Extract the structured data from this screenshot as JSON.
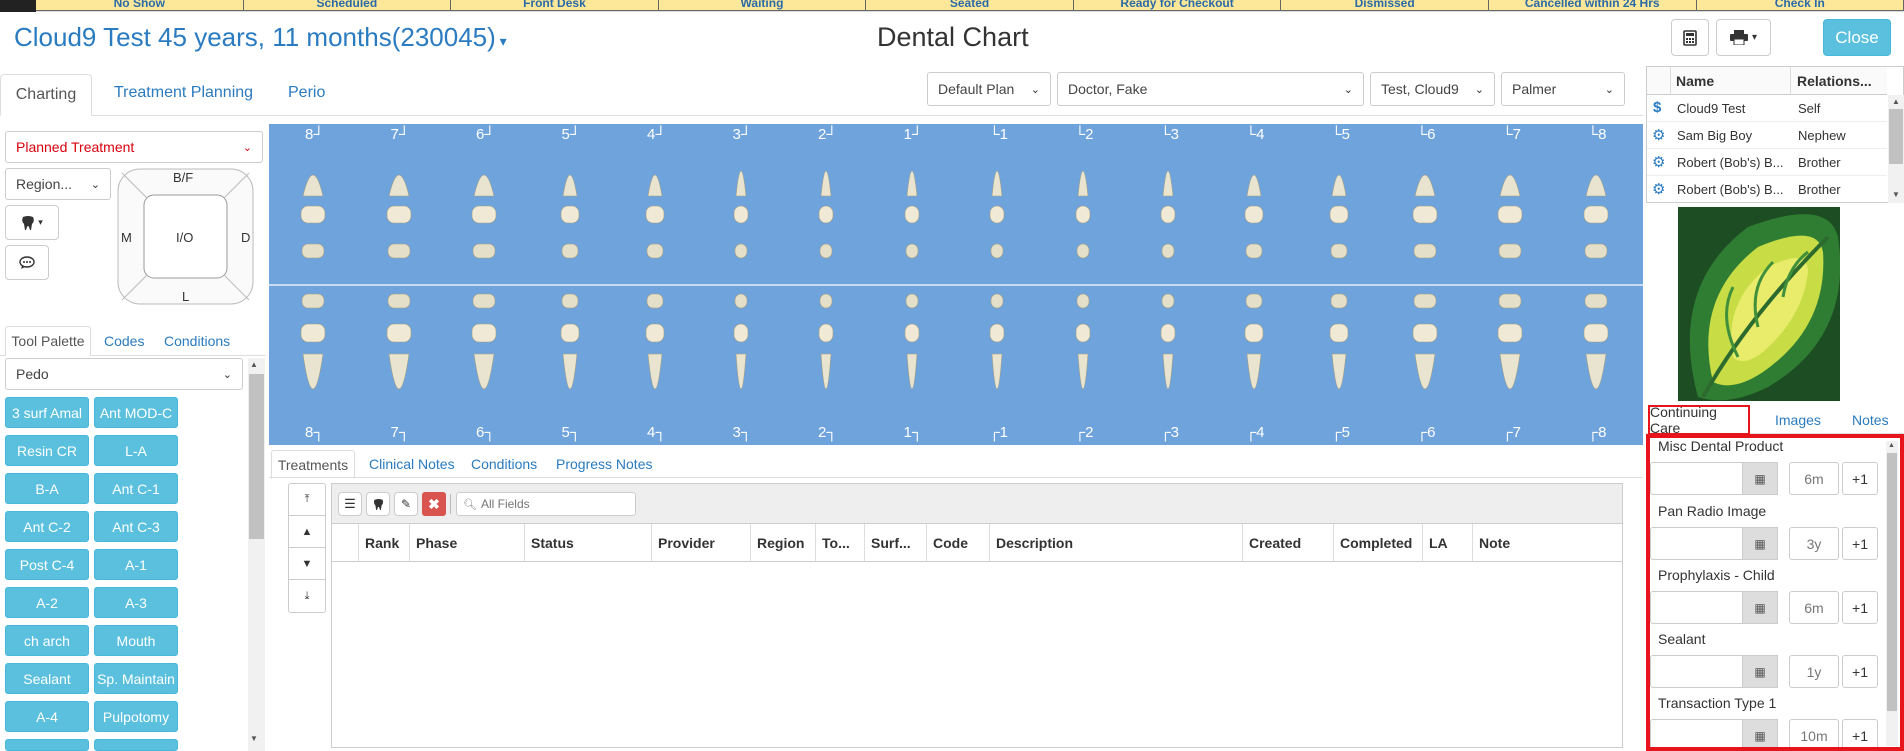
{
  "status_bar": [
    "No Show",
    "Scheduled",
    "Front Desk",
    "Waiting",
    "Seated",
    "Ready for Checkout",
    "Dismissed",
    "Cancelled within 24 Hrs",
    "Check In"
  ],
  "header": {
    "patient": "Cloud9 Test 45 years, 11 months(230045)",
    "title": "Dental Chart",
    "close_label": "Close"
  },
  "tabs": [
    "Charting",
    "Treatment Planning",
    "Perio"
  ],
  "filters": {
    "plan": "Default Plan",
    "provider": "Doctor, Fake",
    "patient": "Test, Cloud9",
    "numbering": "Palmer"
  },
  "left": {
    "treatment_type": "Planned Treatment",
    "region": "Region...",
    "surfaces": {
      "top": "B/F",
      "left": "M",
      "center": "I/O",
      "right": "D",
      "bottom": "L"
    },
    "tool_tabs": [
      "Tool Palette",
      "Codes",
      "Conditions"
    ],
    "palette_select": "Pedo",
    "palette": [
      [
        "3 surf Amal",
        "Ant MOD-C"
      ],
      [
        "Resin CR",
        "L-A"
      ],
      [
        "B-A",
        "Ant C-1"
      ],
      [
        "Ant C-2",
        "Ant C-3"
      ],
      [
        "Post C-4",
        "A-1"
      ],
      [
        "A-2",
        "A-3"
      ],
      [
        "ch arch",
        "Mouth"
      ],
      [
        "Sealant",
        "Sp. Maintain"
      ],
      [
        "A-4",
        "Pulpotomy"
      ]
    ]
  },
  "chart": {
    "upper_labels": [
      "8",
      "7",
      "6",
      "5",
      "4",
      "3",
      "2",
      "1",
      "1",
      "2",
      "3",
      "4",
      "5",
      "6",
      "7",
      "8"
    ],
    "lower_labels": [
      "8",
      "7",
      "6",
      "5",
      "4",
      "3",
      "2",
      "1",
      "1",
      "2",
      "3",
      "4",
      "5",
      "6",
      "7",
      "8"
    ]
  },
  "bottom": {
    "tabs": [
      "Treatments",
      "Clinical Notes",
      "Conditions",
      "Progress Notes"
    ],
    "search_placeholder": "All Fields",
    "columns": [
      "Rank",
      "Phase",
      "Status",
      "Provider",
      "Region",
      "To...",
      "Surf...",
      "Code",
      "Description",
      "Created",
      "Completed",
      "LA",
      "Note"
    ]
  },
  "family": {
    "headers": [
      "Name",
      "Relations..."
    ],
    "rows": [
      {
        "icon": "$",
        "name": "Cloud9 Test",
        "rel": "Self"
      },
      {
        "icon": "⚙",
        "name": "Sam Big Boy",
        "rel": "Nephew"
      },
      {
        "icon": "⚙",
        "name": "Robert (Bob's) B...",
        "rel": "Brother"
      },
      {
        "icon": "⚙",
        "name": "Robert (Bob's) B...",
        "rel": "Brother"
      }
    ]
  },
  "right_tabs": [
    "Continuing Care",
    "Images",
    "Notes"
  ],
  "continuing_care": [
    {
      "label": "Misc Dental Product",
      "interval": "6m",
      "plus": "+1"
    },
    {
      "label": "Pan Radio Image",
      "interval": "3y",
      "plus": "+1"
    },
    {
      "label": "Prophylaxis - Child",
      "interval": "6m",
      "plus": "+1"
    },
    {
      "label": "Sealant",
      "interval": "1y",
      "plus": "+1"
    },
    {
      "label": "Transaction Type 1",
      "interval": "10m",
      "plus": "+1"
    }
  ],
  "colors": {
    "accent": "#2a7bc0",
    "palette_button": "#5bc0de",
    "chart_bg": "#6fa3dc",
    "highlight": "#e8141b",
    "status_bar": "#fde89a"
  }
}
